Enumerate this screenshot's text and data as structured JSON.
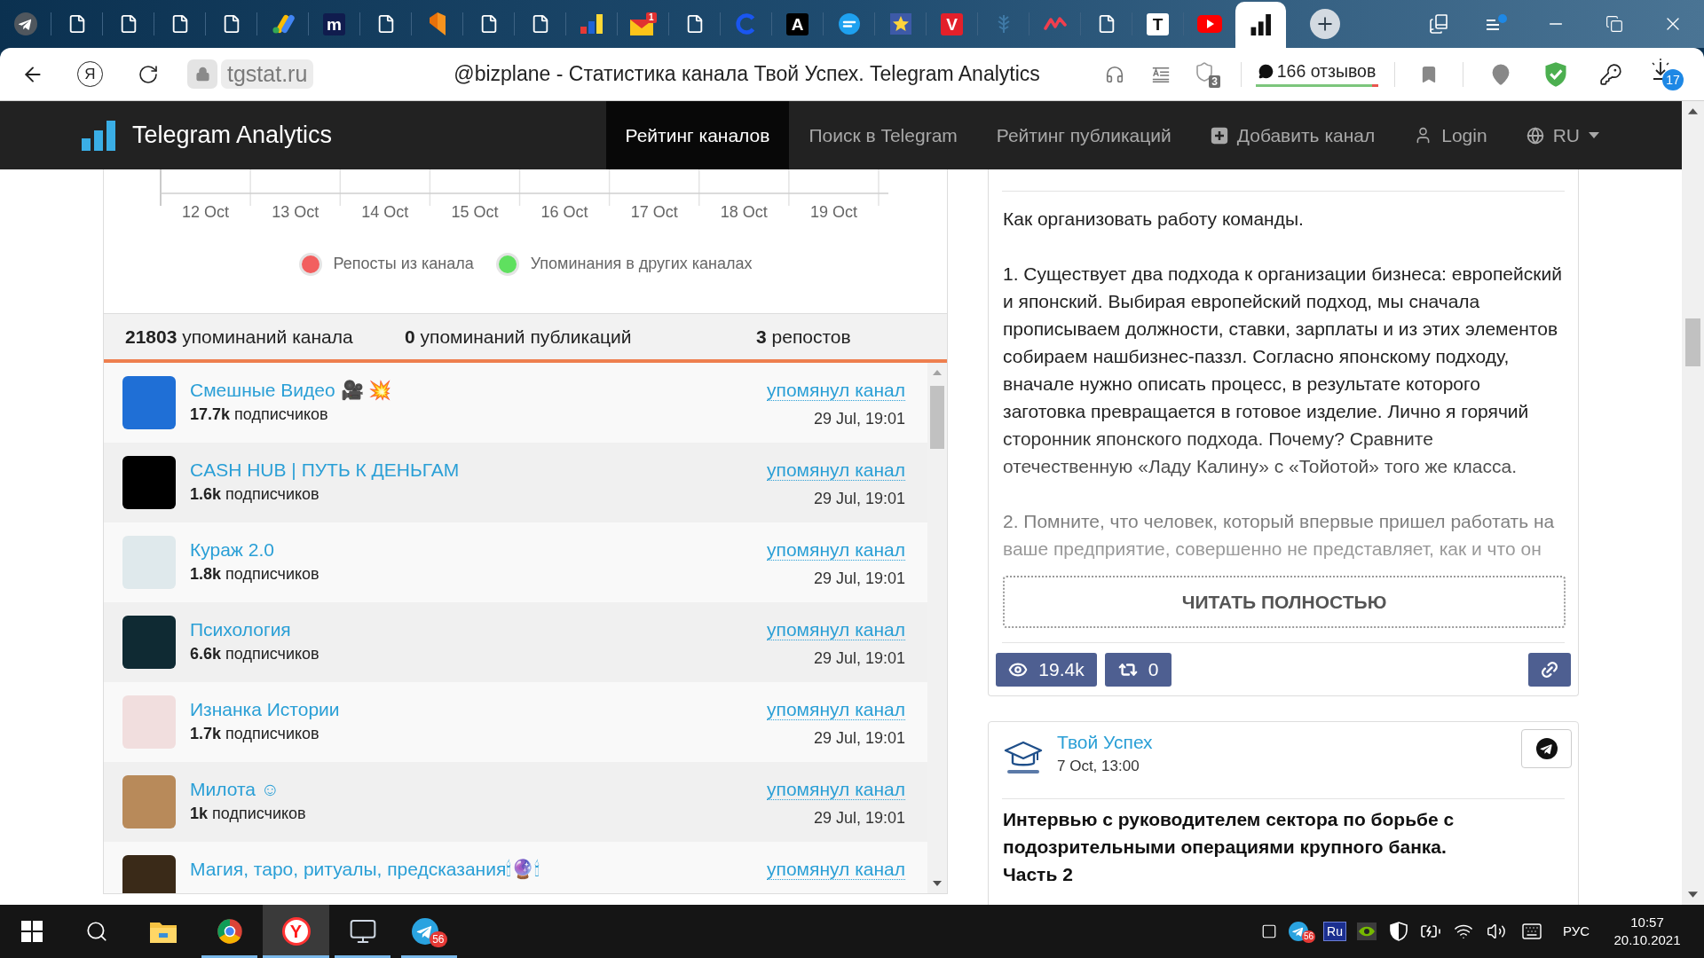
{
  "browser": {
    "tabs": [
      {
        "kind": "plane",
        "selected": false
      },
      {
        "kind": "page",
        "selected": false
      },
      {
        "kind": "page",
        "selected": false
      },
      {
        "kind": "page",
        "selected": false
      },
      {
        "kind": "page",
        "selected": false
      },
      {
        "kind": "ads",
        "selected": false
      },
      {
        "kind": "letter",
        "label": "m",
        "color": "#101c4e",
        "selected": false
      },
      {
        "kind": "page",
        "selected": false
      },
      {
        "kind": "flag",
        "selected": false
      },
      {
        "kind": "page",
        "selected": false
      },
      {
        "kind": "page",
        "selected": false
      },
      {
        "kind": "chart",
        "selected": false
      },
      {
        "kind": "mail",
        "badge": "1",
        "selected": false
      },
      {
        "kind": "page",
        "selected": false
      },
      {
        "kind": "ring",
        "selected": false
      },
      {
        "kind": "letter",
        "label": "A",
        "color": "#000000",
        "selected": false
      },
      {
        "kind": "disc",
        "selected": false
      },
      {
        "kind": "star",
        "selected": false
      },
      {
        "kind": "letter",
        "label": "V",
        "color": "#e3202a",
        "selected": false
      },
      {
        "kind": "tree",
        "selected": false
      },
      {
        "kind": "zigzag",
        "selected": false
      },
      {
        "kind": "page",
        "selected": false
      },
      {
        "kind": "letter",
        "label": "T",
        "color": "#ffffff",
        "selected": false
      },
      {
        "kind": "play",
        "selected": false
      },
      {
        "kind": "bars",
        "selected": true
      }
    ],
    "home_label": "Я",
    "domain": "tgstat.ru",
    "page_title": "@bizplane - Статистика канала Твой Успех. Telegram Analytics",
    "protect_count": "3",
    "reviews": {
      "label": "166 отзывов",
      "level": 0.95
    },
    "downloads_count": "17"
  },
  "navbar": {
    "brand": "Telegram Analytics",
    "items": [
      {
        "kind": "link",
        "label": "Рейтинг каналов",
        "selected": true
      },
      {
        "kind": "link",
        "label": "Поиск в Telegram",
        "selected": false
      },
      {
        "kind": "link",
        "label": "Рейтинг публикаций",
        "selected": false
      },
      {
        "kind": "add",
        "label": "Добавить канал",
        "selected": false
      },
      {
        "kind": "account",
        "label": "Login",
        "selected": false
      },
      {
        "kind": "language",
        "label": "RU",
        "selected": false
      }
    ]
  },
  "chart": {
    "x_labels": [
      "12 Oct",
      "13 Oct",
      "14 Oct",
      "15 Oct",
      "16 Oct",
      "17 Oct",
      "18 Oct",
      "19 Oct"
    ],
    "legend": [
      {
        "label": "Репосты из канала",
        "color": "#f25f5f"
      },
      {
        "label": "Упоминания в других каналах",
        "color": "#5fe05f"
      }
    ]
  },
  "stats": [
    "**21803** упоминаний канала",
    "**0** упоминаний публикаций",
    "**3** репостов"
  ],
  "mentions": [
    {
      "title": "Смешные Видео 🎥 💥",
      "subscribers": "**17.7k** подписчиков",
      "action": "упомянул канал",
      "time": "29 Jul, 19:01",
      "avatar": {
        "color": "#1f6fd6"
      }
    },
    {
      "title": "CASH HUB | ПУТЬ К ДЕНЬГАМ",
      "subscribers": "**1.6k** подписчиков",
      "action": "упомянул канал",
      "time": "29 Jul, 19:01",
      "avatar": {
        "color": "#000000"
      }
    },
    {
      "title": "Кураж 2.0",
      "subscribers": "**1.8k** подписчиков",
      "action": "упомянул канал",
      "time": "29 Jul, 19:01",
      "avatar": {
        "color": "#dfe9ec"
      }
    },
    {
      "title": "Психология",
      "subscribers": "**6.6k** подписчиков",
      "action": "упомянул канал",
      "time": "29 Jul, 19:01",
      "avatar": {
        "color": "#0f2a33"
      }
    },
    {
      "title": "Изнанка Истории",
      "subscribers": "**1.7k** подписчиков",
      "action": "упомянул канал",
      "time": "29 Jul, 19:01",
      "avatar": {
        "color": "#f1dede"
      }
    },
    {
      "title": "Милота ☺",
      "subscribers": "**1k** подписчиков",
      "action": "упомянул канал",
      "time": "29 Jul, 19:01",
      "avatar": {
        "color": "#b88a5a"
      }
    },
    {
      "title": "Магия, таро, ритуалы, предсказания🕯🔮🕯",
      "action": "упомянул канал",
      "avatar": {
        "color": "#3a2a18"
      }
    }
  ],
  "posts": [
    {
      "paragraphs": [
        "Как организовать работу команды.",
        "1. Существует два подхода к организации бизнеса: европейский и японский. Выбирая европейский подход, мы сначала прописываем должности, ставки, зарплаты и из этих элементов собираем нашбизнес-паззл. Согласно японскому подходу, вначале нужно описать процесс, в результате которого заготовка превращается в готовое изделие. Лично я горячий сторонник японского подхода. Почему? Сравните отечественную «Ладу Калину» с «Тойотой» того же класса.",
        "2. Помните, что человек, который впервые пришел работать на ваше предприятие, совершенно не представляет, как и что он"
      ],
      "read_more": "ЧИТАТЬ ПОЛНОСТЬЮ",
      "views": "19.4k",
      "reposts": "0"
    },
    {
      "channel": "Твой Успех",
      "time": "7 Oct, 13:00",
      "title": "Интервью с руководителем сектора по борьбе с подозрительными операциями крупного банка.\nЧасть 2"
    }
  ],
  "taskbar": {
    "apps": [
      {
        "kind": "folder",
        "running": false,
        "selected": false
      },
      {
        "kind": "wheel",
        "running": true,
        "selected": false
      },
      {
        "kind": "letter",
        "label": "Y",
        "running": true,
        "selected": true
      },
      {
        "kind": "monitor",
        "running": true,
        "selected": false
      },
      {
        "kind": "plane",
        "badge": "56",
        "running": true,
        "selected": false
      }
    ],
    "tray": {
      "telegram_badge": "56",
      "layout_label": "Ru",
      "language": "РУС",
      "time": "10:57",
      "date": "20.10.2021"
    }
  }
}
